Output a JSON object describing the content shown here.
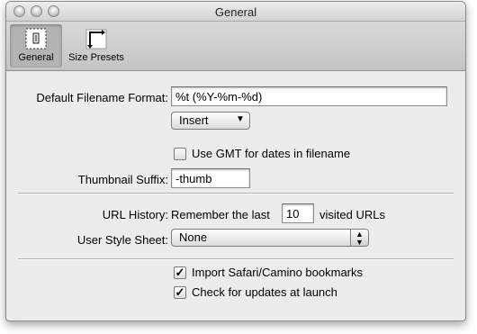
{
  "window": {
    "title": "General"
  },
  "toolbar": {
    "items": [
      {
        "label": "General",
        "icon": "general-prefs-icon"
      },
      {
        "label": "Size Presets",
        "icon": "size-presets-icon"
      }
    ]
  },
  "general": {
    "filename_format_label": "Default Filename Format:",
    "filename_format_value": "%t (%Y-%m-%d)",
    "insert_popup_label": "Insert",
    "use_gmt_label": "Use GMT for dates in filename",
    "use_gmt_checked": false,
    "thumbnail_suffix_label": "Thumbnail Suffix:",
    "thumbnail_suffix_value": "-thumb",
    "url_history_label": "URL History:",
    "remember_prefix": "Remember the last",
    "url_history_count": "10",
    "remember_suffix": "visited URLs",
    "user_style_sheet_label": "User Style Sheet:",
    "user_style_sheet_value": "None",
    "import_bookmarks_label": "Import Safari/Camino bookmarks",
    "import_bookmarks_checked": true,
    "check_updates_label": "Check for updates at launch",
    "check_updates_checked": true,
    "checkmark": "✓",
    "arrow_up": "▲",
    "arrow_down": "▼"
  }
}
